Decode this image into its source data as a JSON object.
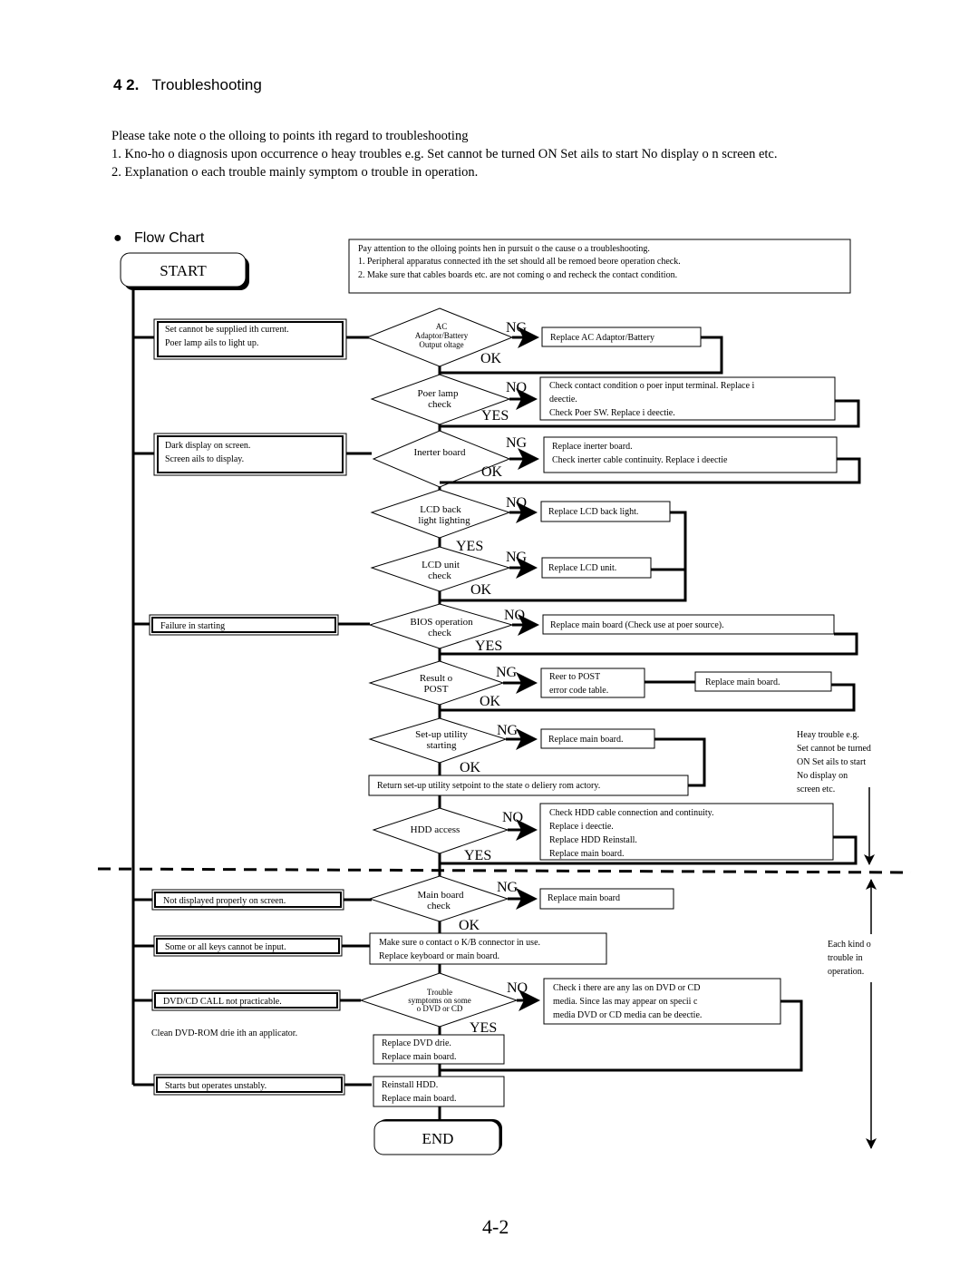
{
  "section": {
    "number": "4 2.",
    "title": "Troubleshooting"
  },
  "intro": {
    "lead": "Please take note o the olloing to points ith regard to troubleshooting",
    "items": [
      "1. Kno-ho o diagnosis upon occurrence o heay troubles e.g. Set cannot be turned ON Set ails to start No display o          n screen etc.",
      "2. Explanation o each trouble mainly symptom o trouble in operation."
    ]
  },
  "flow_heading": "Flow Chart",
  "attention": {
    "lines": [
      "Pay attention to the olloing points hen in pursuit o the cause o a troubleshooting.",
      "1. Peripheral apparatus connected ith the set should all be remoed beore operation check.",
      "2. Make sure that cables boards etc. are not coming o and recheck the contact condition."
    ]
  },
  "terminals": {
    "start": "START",
    "end": "END"
  },
  "symptoms": [
    [
      "Set cannot be supplied ith current.",
      "Poer lamp ails to light up."
    ],
    [
      "Dark display on screen.",
      "Screen ails to display."
    ],
    [
      "Failure in starting"
    ],
    [
      "Not displayed properly on screen."
    ],
    [
      "Some or all keys cannot be input."
    ],
    [
      "DVD/CD CALL not practicable."
    ],
    [
      "Starts but operates unstably."
    ]
  ],
  "clean_note": "Clean DVD-ROM drie ith an applicator.",
  "decisions": [
    {
      "lines": [
        "AC",
        "Adaptor/Battery",
        "Output oltage"
      ],
      "fail": "NG",
      "pass": "OK"
    },
    {
      "lines": [
        "Poer lamp",
        "check"
      ],
      "fail": "NO",
      "pass": "YES"
    },
    {
      "lines": [
        "Inerter board"
      ],
      "fail": "NG",
      "pass": "OK"
    },
    {
      "lines": [
        "LCD back",
        "light lighting"
      ],
      "fail": "NO",
      "pass": "YES"
    },
    {
      "lines": [
        "LCD unit",
        "check"
      ],
      "fail": "NG",
      "pass": "OK"
    },
    {
      "lines": [
        "BIOS operation",
        "check"
      ],
      "fail": "NO",
      "pass": "YES"
    },
    {
      "lines": [
        "Result o",
        "POST"
      ],
      "fail": "NG",
      "pass": "OK"
    },
    {
      "lines": [
        "Set-up utility",
        "starting"
      ],
      "fail": "NG",
      "pass": "OK"
    },
    {
      "lines": [
        "HDD access"
      ],
      "fail": "NO",
      "pass": "YES"
    },
    {
      "lines": [
        "Main board",
        "check"
      ],
      "fail": "NG",
      "pass": "OK"
    },
    {
      "lines": [
        "Trouble",
        "symptoms on some",
        "o DVD or CD"
      ],
      "fail": "NO",
      "pass": "YES"
    }
  ],
  "actions": {
    "ac": [
      "Replace AC Adaptor/Battery"
    ],
    "power": [
      "Check contact condition o poer input terminal. Replace i",
      "deectie.",
      "Check Poer SW. Replace i deectie."
    ],
    "inverter": [
      "Replace inerter board.",
      "Check inerter cable continuity. Replace i deectie"
    ],
    "backlight": [
      "Replace LCD back light."
    ],
    "lcd": [
      "Replace LCD unit."
    ],
    "bios": [
      "Replace main board (Check use at poer source)."
    ],
    "post_ref": [
      "Reer to POST",
      "error code table."
    ],
    "post_replace": [
      "Replace main board."
    ],
    "setup_replace": [
      "Replace main board."
    ],
    "setup_return": [
      "Return set-up utility setpoint to the state o deliery rom actory."
    ],
    "hdd": [
      "Check HDD cable connection and continuity.",
      "Replace i deectie.",
      "Replace HDD  Reinstall.",
      "Replace main board."
    ],
    "mainboard": [
      "Replace main board"
    ],
    "keyboard": [
      "Make sure o contact o K/B connector in use.",
      "Replace keyboard or main board."
    ],
    "dvd_check": [
      "Check i there are any las on DVD or CD",
      "media. Since las may appear on specii  c",
      "media DVD or CD media can be deectie."
    ],
    "dvd_replace": [
      "Replace DVD drie.",
      "Replace main board."
    ],
    "unstable": [
      "Reinstall HDD.",
      "Replace main board."
    ]
  },
  "side_notes": {
    "heavy": [
      "Heay trouble e.g.",
      "Set cannot be turned",
      "ON Set ails to start",
      "No display on",
      "screen etc."
    ],
    "each": [
      "Each kind o",
      "trouble in",
      "operation."
    ]
  },
  "page_number": "4-2"
}
